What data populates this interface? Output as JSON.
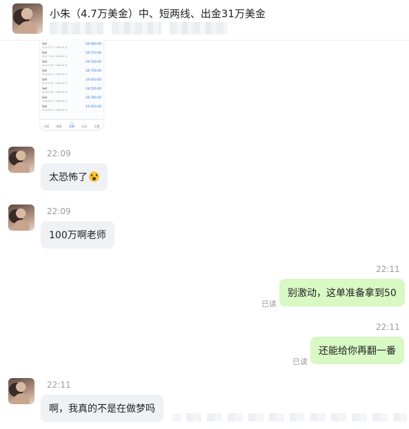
{
  "header": {
    "title": "小朱（4.7万美金）中、短两线、出金31万美金"
  },
  "phone": {
    "rows": [
      {
        "label": "Sell",
        "tag": "sell 11",
        "sub": "01/17 07 → 40000 %",
        "value": "18 560.00"
      },
      {
        "label": "Sell",
        "tag": "sell 11",
        "sub": "01/17 16 → 40000 %",
        "value": "18 570.00"
      },
      {
        "label": "Sell",
        "tag": "sell 11",
        "sub": "01/17 18 → 40000 %",
        "value": "18 430.00"
      },
      {
        "label": "Sell",
        "tag": "sell 11",
        "sub": "01/16 40 → 40000 %",
        "value": "18 750.00"
      },
      {
        "label": "Sell",
        "tag": "sell 11",
        "sub": "01/16 16 → 40000 %",
        "value": "19 010.00"
      },
      {
        "label": "Sell",
        "tag": "sell 11",
        "sub": "01/16 08 → 40000 %",
        "value": "18 550.00"
      },
      {
        "label": "Sell",
        "tag": "sell 11",
        "sub": "01/16 00 → 40000 %",
        "value": "18 790.00"
      },
      {
        "label": "Sell",
        "tag": "sell 11",
        "sub": "01/16 00 → 40000 %",
        "value": "19 450.00"
      }
    ],
    "tabs": [
      "行情",
      "图表",
      "交易",
      "历史",
      "设置"
    ]
  },
  "messages": [
    {
      "time": "22:09",
      "text": "太恐怖了"
    },
    {
      "time": "22:09",
      "text": "100万啊老师"
    },
    {
      "time": "22:11",
      "text": "别激动，这单准备拿到50",
      "status": "已读"
    },
    {
      "time": "22:11",
      "text": "还能给你再翻一番",
      "status": "已读"
    },
    {
      "time": "22:11",
      "text": "啊，我真的不是在做梦吗"
    }
  ],
  "icons": {
    "fear_emoji": "screaming-face-emoji"
  }
}
